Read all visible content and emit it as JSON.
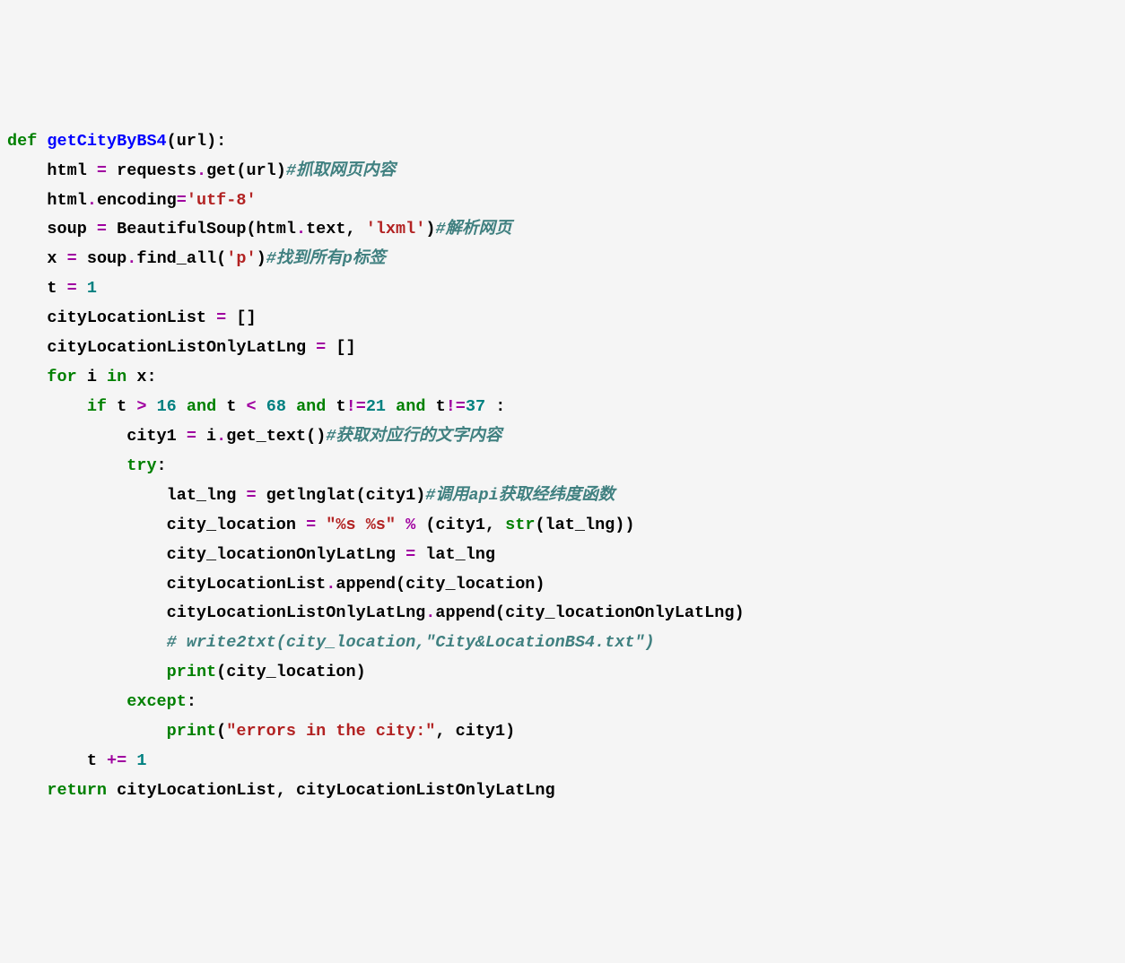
{
  "code": {
    "lines": [
      [
        {
          "t": "def ",
          "c": "kw"
        },
        {
          "t": "getCityByBS4",
          "c": "fn"
        },
        {
          "t": "(url):",
          "c": ""
        }
      ],
      [
        {
          "t": "    html ",
          "c": ""
        },
        {
          "t": "=",
          "c": "op"
        },
        {
          "t": " requests",
          "c": ""
        },
        {
          "t": ".",
          "c": "op"
        },
        {
          "t": "get(url)",
          "c": ""
        },
        {
          "t": "#抓取网页内容",
          "c": "cmt"
        }
      ],
      [
        {
          "t": "    html",
          "c": ""
        },
        {
          "t": ".",
          "c": "op"
        },
        {
          "t": "encoding",
          "c": ""
        },
        {
          "t": "=",
          "c": "op"
        },
        {
          "t": "'utf-8'",
          "c": "str"
        }
      ],
      [
        {
          "t": "    soup ",
          "c": ""
        },
        {
          "t": "=",
          "c": "op"
        },
        {
          "t": " BeautifulSoup(html",
          "c": ""
        },
        {
          "t": ".",
          "c": "op"
        },
        {
          "t": "text, ",
          "c": ""
        },
        {
          "t": "'lxml'",
          "c": "str"
        },
        {
          "t": ")",
          "c": ""
        },
        {
          "t": "#解析网页",
          "c": "cmt"
        }
      ],
      [
        {
          "t": "    x ",
          "c": ""
        },
        {
          "t": "=",
          "c": "op"
        },
        {
          "t": " soup",
          "c": ""
        },
        {
          "t": ".",
          "c": "op"
        },
        {
          "t": "find_all(",
          "c": ""
        },
        {
          "t": "'p'",
          "c": "str"
        },
        {
          "t": ")",
          "c": ""
        },
        {
          "t": "#找到所有p标签",
          "c": "cmt"
        }
      ],
      [
        {
          "t": "    t ",
          "c": ""
        },
        {
          "t": "=",
          "c": "op"
        },
        {
          "t": " ",
          "c": ""
        },
        {
          "t": "1",
          "c": "num"
        }
      ],
      [
        {
          "t": "    cityLocationList ",
          "c": ""
        },
        {
          "t": "=",
          "c": "op"
        },
        {
          "t": " []",
          "c": ""
        }
      ],
      [
        {
          "t": "    cityLocationListOnlyLatLng ",
          "c": ""
        },
        {
          "t": "=",
          "c": "op"
        },
        {
          "t": " []",
          "c": ""
        }
      ],
      [
        {
          "t": "    ",
          "c": ""
        },
        {
          "t": "for",
          "c": "kw"
        },
        {
          "t": " i ",
          "c": ""
        },
        {
          "t": "in",
          "c": "kw"
        },
        {
          "t": " x:",
          "c": ""
        }
      ],
      [
        {
          "t": "        ",
          "c": ""
        },
        {
          "t": "if",
          "c": "kw"
        },
        {
          "t": " t ",
          "c": ""
        },
        {
          "t": ">",
          "c": "op"
        },
        {
          "t": " ",
          "c": ""
        },
        {
          "t": "16",
          "c": "num"
        },
        {
          "t": " ",
          "c": ""
        },
        {
          "t": "and",
          "c": "kw"
        },
        {
          "t": " t ",
          "c": ""
        },
        {
          "t": "<",
          "c": "op"
        },
        {
          "t": " ",
          "c": ""
        },
        {
          "t": "68",
          "c": "num"
        },
        {
          "t": " ",
          "c": ""
        },
        {
          "t": "and",
          "c": "kw"
        },
        {
          "t": " t",
          "c": ""
        },
        {
          "t": "!=",
          "c": "op"
        },
        {
          "t": "21",
          "c": "num"
        },
        {
          "t": " ",
          "c": ""
        },
        {
          "t": "and",
          "c": "kw"
        },
        {
          "t": " t",
          "c": ""
        },
        {
          "t": "!=",
          "c": "op"
        },
        {
          "t": "37",
          "c": "num"
        },
        {
          "t": " :",
          "c": ""
        }
      ],
      [
        {
          "t": "            city1 ",
          "c": ""
        },
        {
          "t": "=",
          "c": "op"
        },
        {
          "t": " i",
          "c": ""
        },
        {
          "t": ".",
          "c": "op"
        },
        {
          "t": "get_text()",
          "c": ""
        },
        {
          "t": "#获取对应行的文字内容",
          "c": "cmt"
        }
      ],
      [
        {
          "t": "            ",
          "c": ""
        },
        {
          "t": "try",
          "c": "kw"
        },
        {
          "t": ":",
          "c": ""
        }
      ],
      [
        {
          "t": "                lat_lng ",
          "c": ""
        },
        {
          "t": "=",
          "c": "op"
        },
        {
          "t": " getlnglat(city1)",
          "c": ""
        },
        {
          "t": "#调用api获取经纬度函数",
          "c": "cmt"
        }
      ],
      [
        {
          "t": "                city_location ",
          "c": ""
        },
        {
          "t": "=",
          "c": "op"
        },
        {
          "t": " ",
          "c": ""
        },
        {
          "t": "\"%s %s\"",
          "c": "str"
        },
        {
          "t": " ",
          "c": ""
        },
        {
          "t": "%",
          "c": "op"
        },
        {
          "t": " (city1, ",
          "c": ""
        },
        {
          "t": "str",
          "c": "builtin"
        },
        {
          "t": "(lat_lng))",
          "c": ""
        }
      ],
      [
        {
          "t": "                city_locationOnlyLatLng ",
          "c": ""
        },
        {
          "t": "=",
          "c": "op"
        },
        {
          "t": " lat_lng",
          "c": ""
        }
      ],
      [
        {
          "t": "                cityLocationList",
          "c": ""
        },
        {
          "t": ".",
          "c": "op"
        },
        {
          "t": "append(city_location)",
          "c": ""
        }
      ],
      [
        {
          "t": "                cityLocationListOnlyLatLng",
          "c": ""
        },
        {
          "t": ".",
          "c": "op"
        },
        {
          "t": "append(city_locationOnlyLatLng)",
          "c": ""
        }
      ],
      [
        {
          "t": "                ",
          "c": ""
        },
        {
          "t": "# write2txt(city_location,\"City&LocationBS4.txt\")",
          "c": "cmt"
        }
      ],
      [
        {
          "t": "                ",
          "c": ""
        },
        {
          "t": "print",
          "c": "builtin"
        },
        {
          "t": "(city_location)",
          "c": ""
        }
      ],
      [
        {
          "t": "            ",
          "c": ""
        },
        {
          "t": "except",
          "c": "kw"
        },
        {
          "t": ":",
          "c": ""
        }
      ],
      [
        {
          "t": "                ",
          "c": ""
        },
        {
          "t": "print",
          "c": "builtin"
        },
        {
          "t": "(",
          "c": ""
        },
        {
          "t": "\"errors in the city:\"",
          "c": "str"
        },
        {
          "t": ", city1)",
          "c": ""
        }
      ],
      [
        {
          "t": "        t ",
          "c": ""
        },
        {
          "t": "+=",
          "c": "op"
        },
        {
          "t": " ",
          "c": ""
        },
        {
          "t": "1",
          "c": "num"
        }
      ],
      [
        {
          "t": "    ",
          "c": ""
        },
        {
          "t": "return",
          "c": "kw"
        },
        {
          "t": " cityLocationList, cityLocationListOnlyLatLng",
          "c": ""
        }
      ]
    ]
  }
}
